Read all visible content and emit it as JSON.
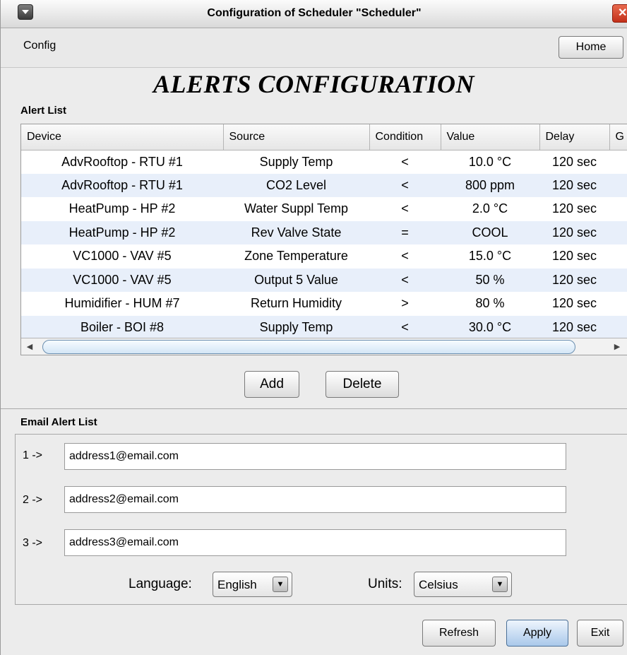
{
  "window": {
    "title": "Configuration of Scheduler \"Scheduler\"",
    "close_glyph": "✕"
  },
  "menu": {
    "config": "Config",
    "home": "Home"
  },
  "page_title": "ALERTS CONFIGURATION",
  "alert_list": {
    "label": "Alert List",
    "columns": [
      "Device",
      "Source",
      "Condition",
      "Value",
      "Delay",
      "G"
    ],
    "rows": [
      [
        "AdvRooftop - RTU #1",
        "Supply Temp",
        "<",
        "10.0 °C",
        "120 sec"
      ],
      [
        "AdvRooftop - RTU #1",
        "CO2 Level",
        "<",
        "800 ppm",
        "120 sec"
      ],
      [
        "HeatPump - HP #2",
        "Water Suppl Temp",
        "<",
        "2.0 °C",
        "120 sec"
      ],
      [
        "HeatPump - HP #2",
        "Rev Valve State",
        "=",
        "COOL",
        "120 sec"
      ],
      [
        "VC1000 - VAV #5",
        "Zone Temperature",
        "<",
        "15.0 °C",
        "120 sec"
      ],
      [
        "VC1000 - VAV #5",
        "Output 5 Value",
        "<",
        "50 %",
        "120 sec"
      ],
      [
        "Humidifier - HUM #7",
        "Return Humidity",
        ">",
        "80 %",
        "120 sec"
      ],
      [
        "Boiler - BOI #8",
        "Supply Temp",
        "<",
        "30.0 °C",
        "120 sec"
      ]
    ],
    "add": "Add",
    "delete": "Delete"
  },
  "email": {
    "label": "Email Alert List",
    "entries": [
      {
        "index": "1 ->",
        "value": "address1@email.com"
      },
      {
        "index": "2 ->",
        "value": "address2@email.com"
      },
      {
        "index": "3 ->",
        "value": "address3@email.com"
      }
    ],
    "language_label": "Language:",
    "language_value": "English",
    "units_label": "Units:",
    "units_value": "Celsius"
  },
  "footer": {
    "refresh": "Refresh",
    "apply": "Apply",
    "exit": "Exit"
  },
  "icons": {
    "window_menu": "window-menu-icon",
    "close": "close-icon",
    "dropdown": "chevron-down-icon",
    "scroll_left": "arrow-left-icon",
    "scroll_right": "arrow-right-icon"
  },
  "colors": {
    "row_alt": "#e8effa",
    "apply_accent": "#a9c8ea",
    "close_red": "#c3301a",
    "scroll_thumb": "#d4e6f6"
  }
}
